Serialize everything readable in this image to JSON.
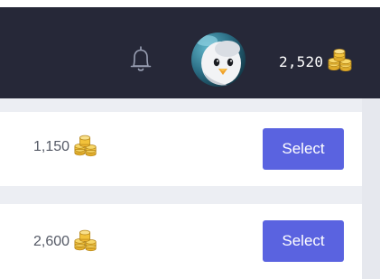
{
  "header": {
    "notifications_icon": "bell-icon",
    "avatar_icon": "penguin-avatar",
    "balance": "2,520",
    "balance_icon": "coin-stack-icon"
  },
  "offers": [
    {
      "amount": "1,150",
      "icon": "coin-stack-icon",
      "button_label": "Select"
    },
    {
      "amount": "2,600",
      "icon": "coin-stack-icon",
      "button_label": "Select"
    }
  ],
  "colors": {
    "header_bg": "#262838",
    "accent": "#5a63e0",
    "coin_gold": "#f2c23a"
  }
}
